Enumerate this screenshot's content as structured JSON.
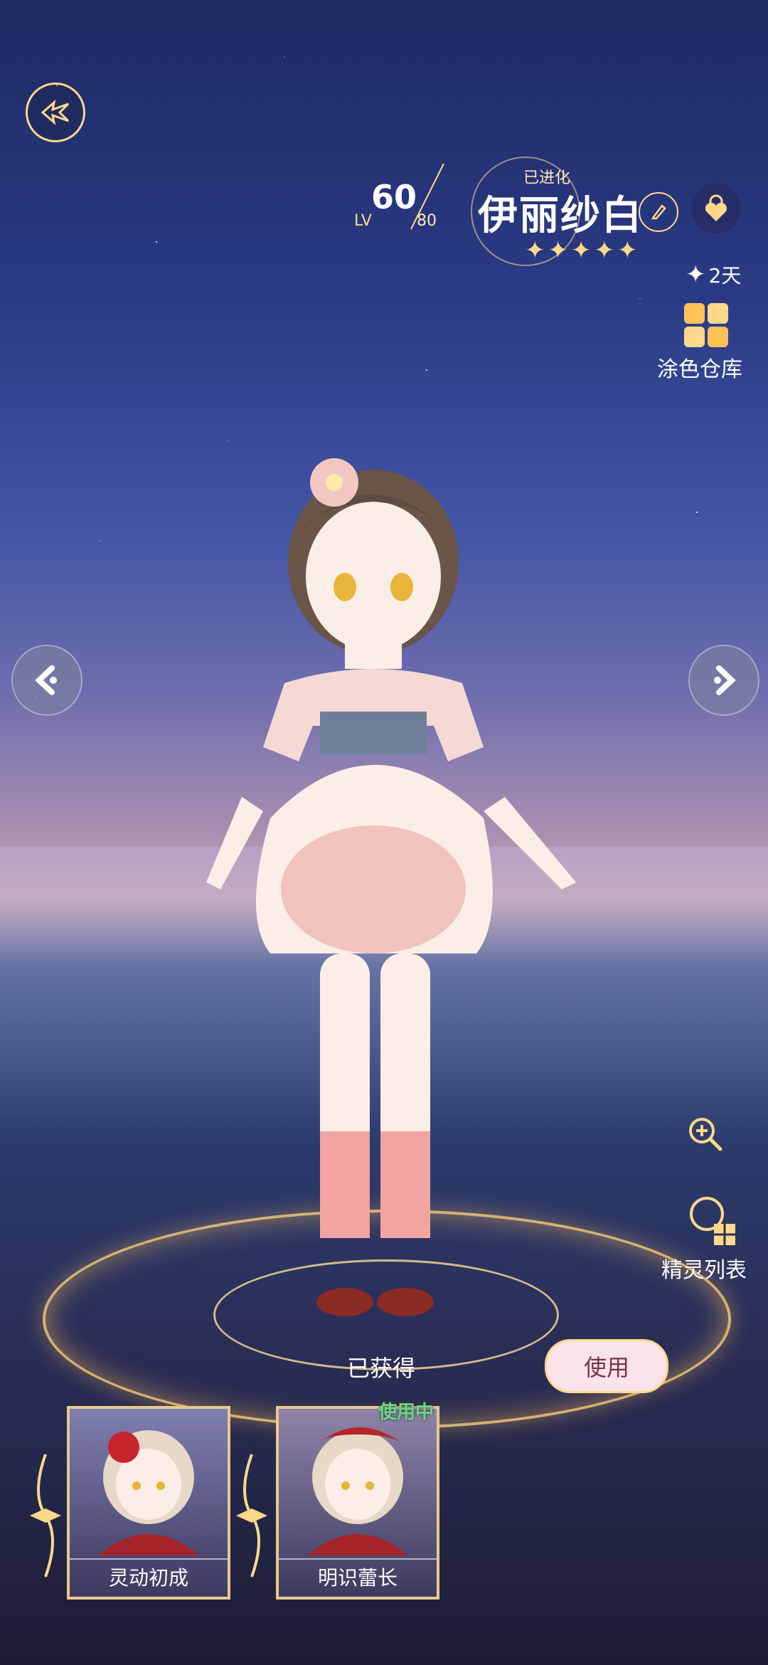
{
  "header": {
    "level_prefix": "LV",
    "level": "60",
    "level_max": "80",
    "evolve_status": "已进化",
    "character_name": "伊丽纱白",
    "star_count": 5
  },
  "sidebar": {
    "timer_text": "2天",
    "color_warehouse_label": "涂色仓库",
    "spirit_list_label": "精灵列表"
  },
  "status": {
    "obtained_label": "已获得",
    "use_button_label": "使用",
    "in_use_badge": "使用中"
  },
  "outfits": [
    {
      "name": "灵动初成"
    },
    {
      "name": "明识蕾长"
    }
  ],
  "colors": {
    "gold": "#ffd88a",
    "use_button_bg": "#fbe3ea",
    "use_button_text": "#7a3046",
    "in_use_green": "#6fd38a"
  },
  "icons": {
    "back": "wing-back-icon",
    "edit": "pencil-icon",
    "lock": "heart-lock-icon",
    "prev": "chevron-left-icon",
    "next": "chevron-right-icon",
    "zoom": "zoom-in-icon"
  }
}
